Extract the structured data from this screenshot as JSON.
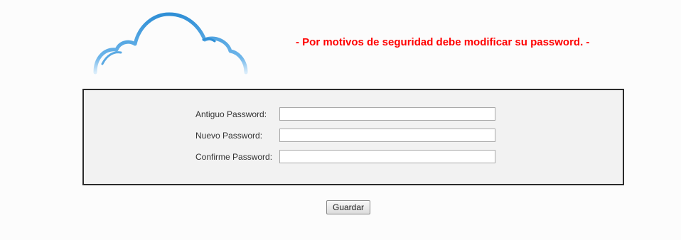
{
  "header": {
    "warning": "- Por motivos de seguridad debe modificar su password. -",
    "warning_color": "#ff0000",
    "logo_icon": "cloud-icon",
    "logo_color": "#2f8fd6"
  },
  "form": {
    "fields": [
      {
        "label": "Antiguo Password:",
        "value": ""
      },
      {
        "label": "Nuevo Password:",
        "value": ""
      },
      {
        "label": "Confirme Password:",
        "value": ""
      }
    ]
  },
  "actions": {
    "save_label": "Guardar"
  }
}
